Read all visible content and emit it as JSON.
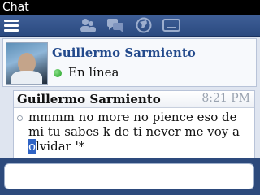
{
  "window": {
    "title": "Chat"
  },
  "toolbar": {
    "items": [
      "menu-icon",
      "contacts-icon",
      "conversations-icon",
      "globe-icon",
      "minimize-icon"
    ]
  },
  "contact": {
    "name": "Guillermo Sarmiento",
    "status": "En línea",
    "status_color": "#22aa22"
  },
  "messages": [
    {
      "sender": "Guillermo Sarmiento",
      "time": "8:21 PM",
      "text_before_cursor": "mmmm no more no pience eso de mi tu sabes k de ti never me voy a ",
      "cursor_char": "o",
      "text_after_cursor": "lvidar '*"
    }
  ],
  "composer": {
    "value": "",
    "placeholder": ""
  }
}
